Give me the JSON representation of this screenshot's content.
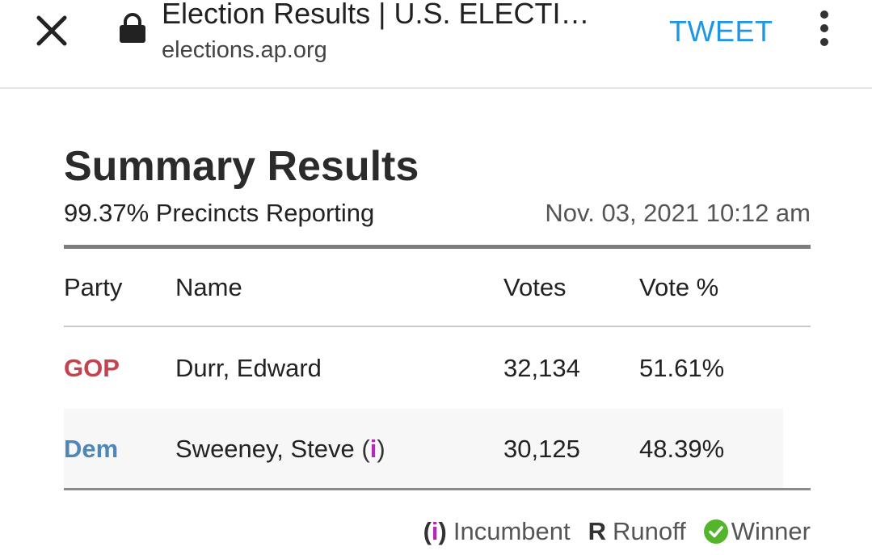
{
  "browser": {
    "title": "Election Results | U.S. ELECTI…",
    "url": "elections.ap.org",
    "tweet_label": "TWEET"
  },
  "summary": {
    "title": "Summary Results",
    "precincts": "99.37% Precincts Reporting",
    "timestamp": "Nov. 03, 2021 10:12 am"
  },
  "table": {
    "headers": [
      "Party",
      "Name",
      "Votes",
      "Vote %"
    ],
    "rows": [
      {
        "party": "GOP",
        "name": "Durr, Edward",
        "votes": "32,134",
        "pct": "51.61%"
      },
      {
        "party": "Dem",
        "name": "Sweeney, Steve",
        "votes": "30,125",
        "pct": "48.39%"
      }
    ]
  },
  "legend": {
    "incumbent_symbol": "i",
    "incumbent_label": "Incumbent",
    "runoff_symbol": "R",
    "runoff_label": "Runoff",
    "winner_label": "Winner"
  },
  "colors": {
    "gop": "#c4434f",
    "dem": "#4f86b8",
    "incumbent": "#b02ab5",
    "winner": "#55b52a",
    "tweet": "#1f95e6"
  },
  "icons": [
    "close-icon",
    "lock-icon",
    "more-vert-icon",
    "winner-check-icon"
  ]
}
